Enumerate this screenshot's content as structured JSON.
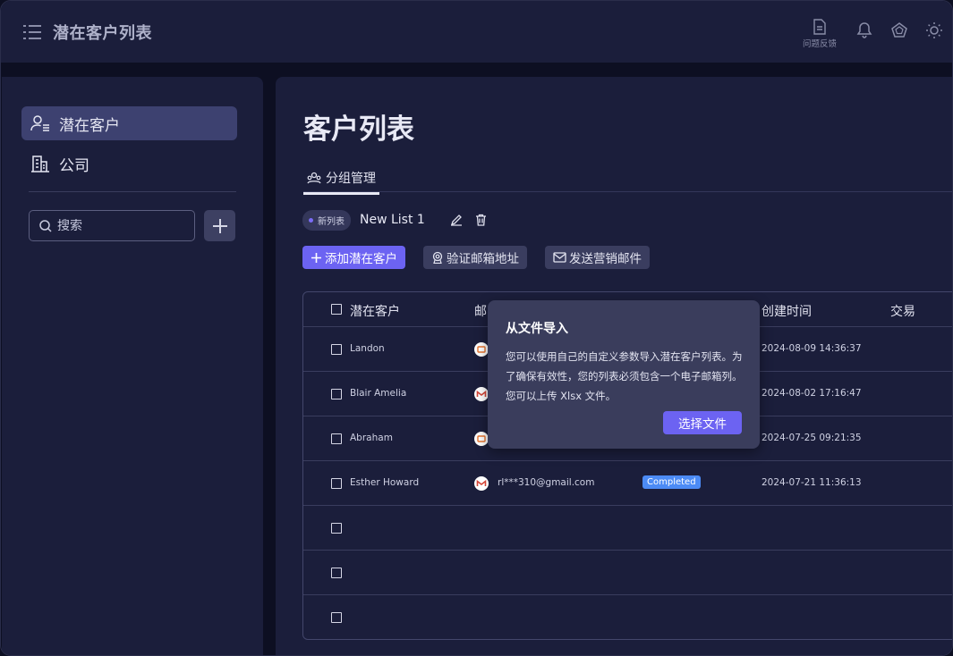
{
  "header": {
    "title": "潜在客户列表",
    "feedback_label": "问题反馈"
  },
  "sidebar": {
    "items": [
      {
        "label": "潜在客户",
        "icon": "user-list-icon",
        "active": true
      },
      {
        "label": "公司",
        "icon": "building-icon",
        "active": false
      }
    ],
    "search_placeholder": "搜索"
  },
  "main": {
    "page_title": "客户列表",
    "tab_label": "分组管理",
    "list_badge": "新列表",
    "list_name": "New List 1",
    "actions": {
      "add_lead": "添加潜在客户",
      "verify_email": "验证邮箱地址",
      "send_marketing": "发送营销邮件"
    },
    "table": {
      "headers": {
        "lead": "潜在客户",
        "email_partial": "邮",
        "created": "创建时间",
        "deal": "交易"
      },
      "rows": [
        {
          "name": "Landon",
          "mail_icon": "generic-mail-icon",
          "email": "",
          "status": "",
          "created": "2024-08-09 14:36:37"
        },
        {
          "name": "Blair Amelia",
          "mail_icon": "gmail-icon",
          "email": "",
          "status": "",
          "created": "2024-08-02 17:16:47"
        },
        {
          "name": "Abraham",
          "mail_icon": "generic-mail-icon",
          "email": "",
          "status": "",
          "created": "2024-07-25 09:21:35"
        },
        {
          "name": "Esther Howard",
          "mail_icon": "gmail-icon",
          "email": "rl***310@gmail.com",
          "status": "Completed",
          "created": "2024-07-21 11:36:13"
        }
      ]
    }
  },
  "popover": {
    "title": "从文件导入",
    "body": "您可以使用自己的自定义参数导入潜在客户列表。为了确保有效性，您的列表必须包含一个电子邮箱列。您可以上传 Xlsx 文件。",
    "button": "选择文件"
  },
  "colors": {
    "accent": "#6c63f2",
    "panel": "#1b1e3b",
    "background": "#0d0f22",
    "status_completed": "#4c8bf5"
  }
}
